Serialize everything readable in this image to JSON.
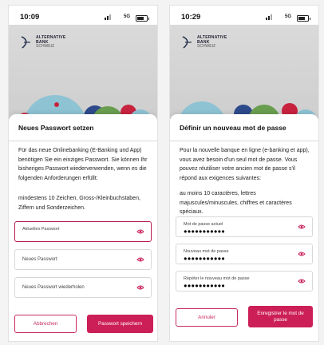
{
  "colors": {
    "accent": "#cc1f57",
    "hero_bg": "#d6d6d6",
    "sheet_bg": "#ffffff"
  },
  "screens": [
    {
      "status": {
        "time": "10:09",
        "network": "5G"
      },
      "bank": {
        "name": "ALTERNATIVE\nBANK",
        "tagline": "SCHWEIZ"
      },
      "sheet": {
        "title": "Neues Passwort setzen",
        "intro": "Für das neue Onlinebanking (E-Banking und App) benötigen Sie ein einziges Passwort. Sie können Ihr bisheriges Passwort wiederverwenden, wenn es die folgenden Anforderungen erfüllt:",
        "requirements": "mindestens 10 Zeichen, Gross-/Kleinbuchstaben, Ziffern und Sonderzeichen.",
        "fields": [
          {
            "label": "Aktuelles Passwort",
            "value": ""
          },
          {
            "label": "Neues Passwort",
            "value": ""
          },
          {
            "label": "Neues Passwort wiederholen",
            "value": ""
          }
        ],
        "cancel_label": "Abbrechen",
        "save_label": "Passwort speichern"
      }
    },
    {
      "status": {
        "time": "10:29",
        "network": "5G"
      },
      "bank": {
        "name": "ALTERNATIVE\nBANK",
        "tagline": "SCHWEIZ"
      },
      "sheet": {
        "title": "Définir un nouveau mot de passe",
        "intro": "Pour la nouvelle banque en ligne (e-banking et app), vous avez besoin d'un seul mot de passe. Vous pouvez réutiliser votre ancien mot de passe s'il répond aux exigences suivantes:",
        "requirements": "au moins 10 caractères, lettres majuscules/minuscules, chiffres et caractères spéciaux.",
        "fields": [
          {
            "label": "Mot de passe actuel",
            "value": "●●●●●●●●●●●"
          },
          {
            "label": "Nouveau mot de passe",
            "value": "●●●●●●●●●●●"
          },
          {
            "label": "Répéter le nouveau mot de passe",
            "value": "●●●●●●●●●●●"
          }
        ],
        "cancel_label": "Annuler",
        "save_label": "Enregistrer le mot de passe"
      }
    }
  ]
}
